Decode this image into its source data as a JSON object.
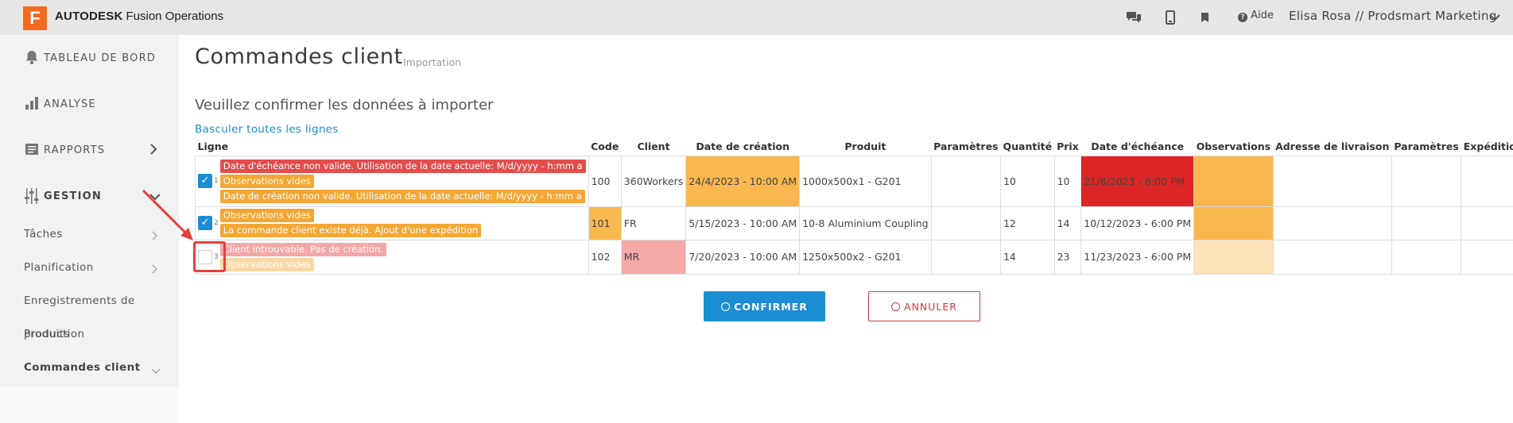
{
  "app": {
    "logo_letter": "F",
    "brand": "AUTODESK",
    "product": "Fusion Operations"
  },
  "header": {
    "help_label": "Aide",
    "user": "Elisa Rosa // Prodsmart Marketing"
  },
  "sidebar": {
    "items": [
      {
        "label": "TABLEAU DE BORD",
        "icon": "bell-icon"
      },
      {
        "label": "ANALYSE",
        "icon": "bar-chart-icon"
      },
      {
        "label": "RAPPORTS",
        "icon": "document-icon"
      },
      {
        "label": "GESTION",
        "icon": "sliders-icon"
      }
    ],
    "subitems": [
      "Tâches",
      "Planification",
      "Enregistrements de",
      "production",
      "Produits",
      "Commandes client"
    ]
  },
  "page": {
    "title": "Commandes client",
    "subtitle": "Importation",
    "confirm_heading": "Veuillez confirmer les données à importer",
    "toggle_all": "Basculer toutes les lignes"
  },
  "table": {
    "columns": [
      "Ligne",
      "Code",
      "Client",
      "Date de création",
      "Produit",
      "Paramètres",
      "Quantité",
      "Prix",
      "Date d'échéance",
      "Observations",
      "Adresse de livraison",
      "Paramètres",
      "Expédition"
    ],
    "rows": [
      {
        "num": "1",
        "checked": true,
        "messages": [
          "Date d'échéance non valide. Utilisation de la date actuelle: M/d/yyyy - h:mm a",
          "Observations vides",
          "Date de création non valide. Utilisation de la date actuelle: M/d/yyyy - h:mm a"
        ],
        "code": "100",
        "client": "360Workers",
        "created": "24/4/2023 - 10:00 AM",
        "product": "1000x500x1 - G201",
        "params": "",
        "qty": "10",
        "price": "10",
        "due": "21/8/2023 - 6:00 PM",
        "notes": "",
        "address": "",
        "params2": "",
        "shipping": ""
      },
      {
        "num": "2",
        "checked": true,
        "messages": [
          "Observations vides",
          "La commande client existe déjà. Ajout d'une expédition"
        ],
        "code": "101",
        "client": "FR",
        "created": "5/15/2023 - 10:00 AM",
        "product": "10-8 Aluminium Coupling",
        "params": "",
        "qty": "12",
        "price": "14",
        "due": "10/12/2023 - 6:00 PM",
        "notes": "",
        "address": "",
        "params2": "",
        "shipping": ""
      },
      {
        "num": "3",
        "checked": false,
        "messages": [
          "Client introuvable. Pas de création.",
          "Observations vides"
        ],
        "code": "102",
        "client": "MR",
        "created": "7/20/2023 - 10:00 AM",
        "product": "1250x500x2 - G201",
        "params": "",
        "qty": "14",
        "price": "23",
        "due": "11/23/2023 - 6:00 PM",
        "notes": "",
        "address": "",
        "params2": "",
        "shipping": ""
      }
    ]
  },
  "buttons": {
    "confirm": "CONFIRMER",
    "cancel": "ANNULER"
  },
  "colors": {
    "accent": "#1c8dd3",
    "brand": "#f26b21",
    "warning": "#f4a734",
    "error": "#e44c4c",
    "due_error": "#dd2525"
  }
}
